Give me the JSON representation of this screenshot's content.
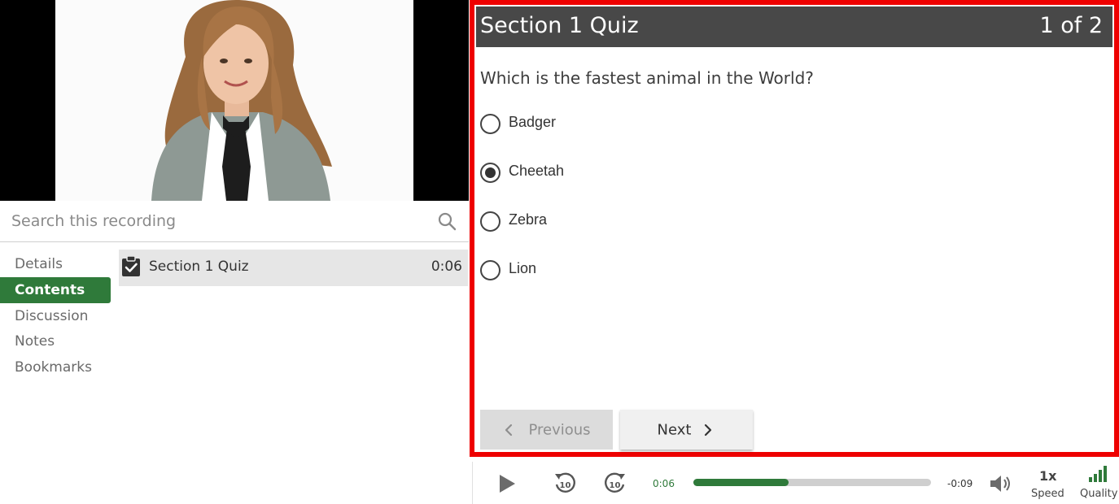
{
  "search": {
    "placeholder": "Search this recording"
  },
  "nav": {
    "items": [
      {
        "label": "Details"
      },
      {
        "label": "Contents"
      },
      {
        "label": "Discussion"
      },
      {
        "label": "Notes"
      },
      {
        "label": "Bookmarks"
      }
    ],
    "active": "Contents"
  },
  "contents": {
    "items": [
      {
        "title": "Section 1 Quiz",
        "time": "0:06"
      }
    ]
  },
  "quiz": {
    "title": "Section 1 Quiz",
    "progress": "1 of 2",
    "question": "Which is the fastest animal in the World?",
    "answers": [
      {
        "label": "Badger",
        "selected": false
      },
      {
        "label": "Cheetah",
        "selected": true
      },
      {
        "label": "Zebra",
        "selected": false
      },
      {
        "label": "Lion",
        "selected": false
      }
    ],
    "previous_label": "Previous",
    "next_label": "Next"
  },
  "player": {
    "current_time": "0:06",
    "remaining_time": "-0:09",
    "progress_fraction": 0.4,
    "skip_seconds": "10",
    "speed_value": "1x",
    "speed_label": "Speed",
    "quality_label": "Quality"
  },
  "colors": {
    "accent": "#2f7a3a",
    "quiz_border": "#ee0000",
    "quiz_header": "#484848"
  }
}
